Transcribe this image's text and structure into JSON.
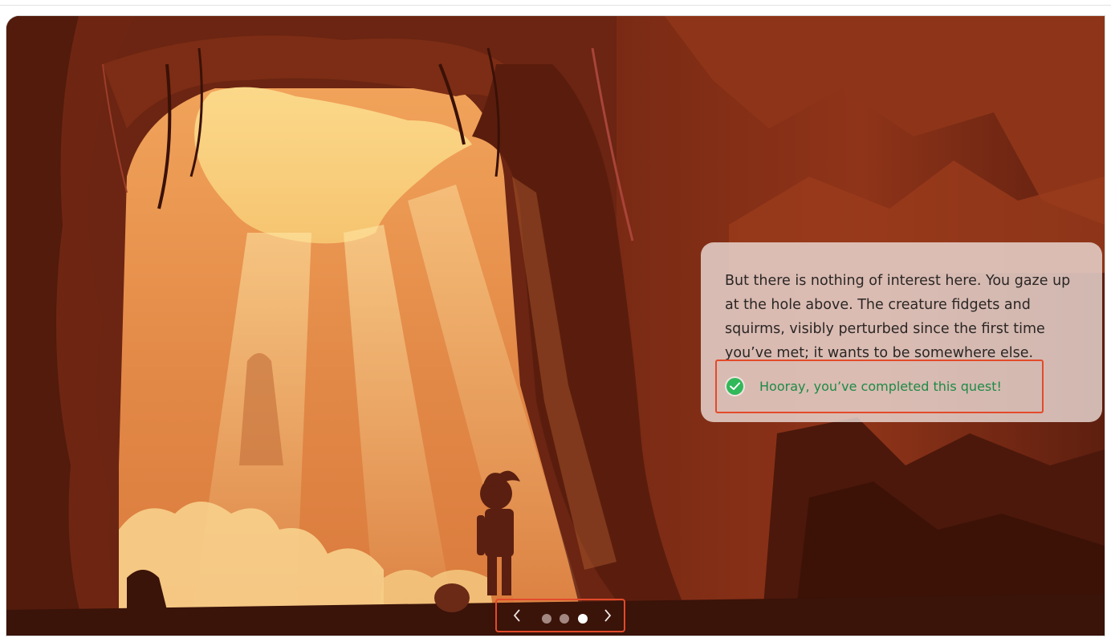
{
  "story": {
    "text": "But there is nothing of interest here. You gaze up at the hole above. The creature fidgets and squirms, visibly perturbed since the first time you’ve met; it wants to be somewhere else.",
    "quest_status": "Hooray, you’ve completed this quest!"
  },
  "carousel": {
    "slides": [
      "slide-1",
      "slide-2",
      "slide-3"
    ],
    "active_index": 2,
    "prev_icon": "chevron-left-icon",
    "next_icon": "chevron-right-icon"
  },
  "colors": {
    "accent_outline": "#e34a2a",
    "success": "#31b85a",
    "success_text": "#1e8a45"
  }
}
